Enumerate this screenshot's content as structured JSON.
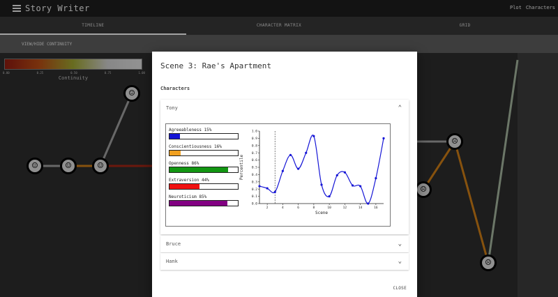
{
  "app": {
    "title": "Story Writer",
    "nav": [
      "Plot",
      "Characters"
    ]
  },
  "tabs": [
    {
      "label": "TIMELINE",
      "active": true
    },
    {
      "label": "CHARACTER MATRIX",
      "active": false
    },
    {
      "label": "GRID",
      "active": false
    }
  ],
  "subbar": {
    "continuity_toggle": "VIEW/HIDE CONTINUITY"
  },
  "legend": {
    "title": "Continuity",
    "ticks": [
      "0.00",
      "0.25",
      "0.50",
      "0.75",
      "1.00"
    ],
    "colors": [
      "#8b1a10",
      "#b24a14",
      "#9aa030",
      "#c8c8c8",
      "#d8d8d8"
    ]
  },
  "timeline": {
    "nodes": [
      {
        "mood": "happy",
        "glyph": "☺"
      },
      {
        "mood": "happy",
        "glyph": "☺"
      },
      {
        "mood": "happy",
        "glyph": "☺"
      },
      {
        "mood": "content",
        "glyph": "☺"
      },
      {
        "mood": "sad",
        "glyph": "☹"
      },
      {
        "mood": "sad",
        "glyph": "☹"
      },
      {
        "mood": "sad",
        "glyph": "☹"
      }
    ],
    "link_colors": {
      "grey": "#9a9a9a",
      "orange": "#c77a16",
      "red": "#9e2414",
      "sage": "#9fb09a"
    }
  },
  "dialog": {
    "title": "Scene 3: Rae's Apartment",
    "section": "Characters",
    "close": "CLOSE",
    "characters": [
      {
        "name": "Tony",
        "expanded": true,
        "traits": [
          {
            "label": "Agreeableness 15%",
            "value": 0.15,
            "color": "#1515d6"
          },
          {
            "label": "Conscientiousness 16%",
            "value": 0.16,
            "color": "#f0a020"
          },
          {
            "label": "Openness 86%",
            "value": 0.86,
            "color": "#129612"
          },
          {
            "label": "Extraversion 44%",
            "value": 0.44,
            "color": "#f01010"
          },
          {
            "label": "Neuroticism 85%",
            "value": 0.85,
            "color": "#820082"
          }
        ]
      },
      {
        "name": "Bruce",
        "expanded": false
      },
      {
        "name": "Hank",
        "expanded": false
      }
    ]
  },
  "chart_data": {
    "type": "line",
    "xlabel": "Scene",
    "ylabel": "Percentile",
    "x": [
      1,
      2,
      3,
      4,
      5,
      6,
      7,
      8,
      9,
      10,
      11,
      12,
      13,
      14,
      15,
      16,
      17
    ],
    "series": [
      {
        "values": [
          0.24,
          0.21,
          0.16,
          0.45,
          0.67,
          0.48,
          0.7,
          0.93,
          0.26,
          0.1,
          0.39,
          0.43,
          0.25,
          0.24,
          0.0,
          0.35,
          0.9
        ],
        "color": "#1515d6"
      }
    ],
    "current_scene": 3,
    "xticks": [
      2,
      4,
      6,
      8,
      10,
      12,
      14,
      16
    ],
    "yticks": [
      0.0,
      0.1,
      0.2,
      0.3,
      0.4,
      0.5,
      0.6,
      0.7,
      0.8,
      0.9,
      1.0
    ],
    "xlim": [
      1,
      17
    ],
    "ylim": [
      0,
      1
    ]
  }
}
